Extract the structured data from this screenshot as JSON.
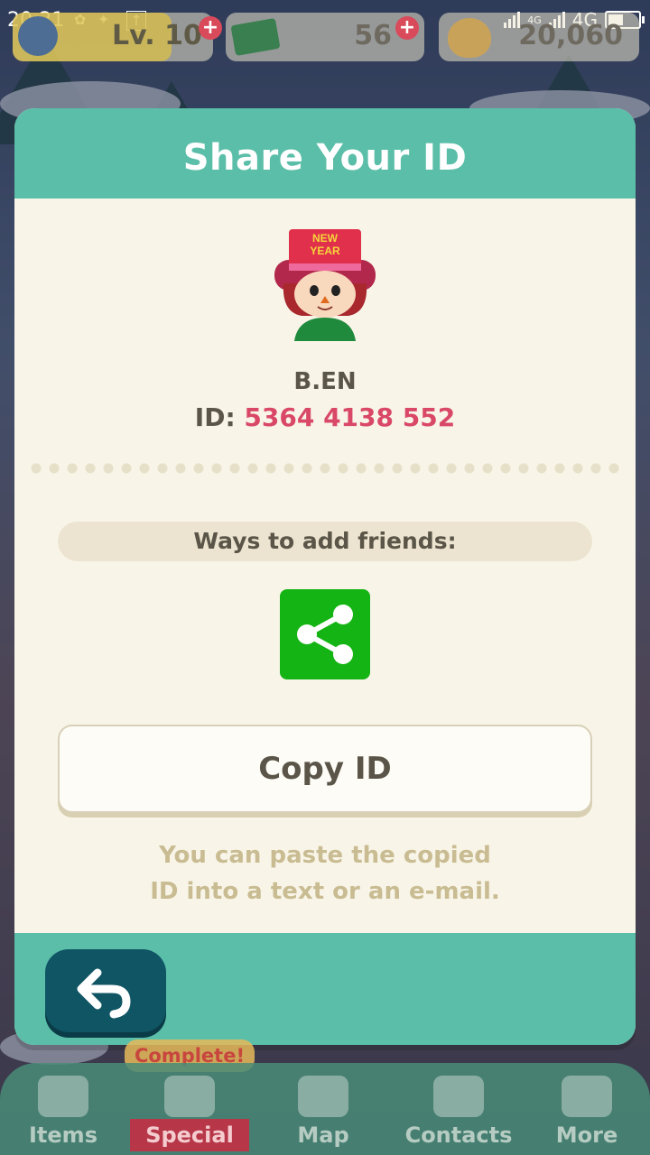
{
  "status_bar": {
    "time": "20:21",
    "network_1": "4G",
    "network_2": "4G"
  },
  "hud": {
    "level_label": "Lv. 10",
    "tickets": "56",
    "bells": "20,060"
  },
  "dialog": {
    "title": "Share Your ID",
    "player_name": "B.EN",
    "id_label": "ID:",
    "id_value": "5364 4138 552",
    "hat_text_1": "NEW",
    "hat_text_2": "YEAR",
    "ways_label": "Ways to add friends:",
    "share_icon": "share-icon",
    "copy_button_label": "Copy ID",
    "hint_line_1": "You can paste the copied",
    "hint_line_2": "ID into a text or an e-mail.",
    "back_icon": "back-arrow-icon"
  },
  "bottom_nav": {
    "complete_tag": "Complete!",
    "items": [
      {
        "label": "Items",
        "icon": "bag-icon"
      },
      {
        "label": "Special",
        "icon": "tools-icon"
      },
      {
        "label": "Map",
        "icon": "map-icon"
      },
      {
        "label": "Contacts",
        "icon": "cat-face-icon"
      },
      {
        "label": "More",
        "icon": "grid-icon"
      }
    ]
  },
  "colors": {
    "accent_teal": "#5bbea8",
    "id_pink": "#d94867",
    "share_green": "#14b414",
    "back_button": "#0f5564"
  }
}
